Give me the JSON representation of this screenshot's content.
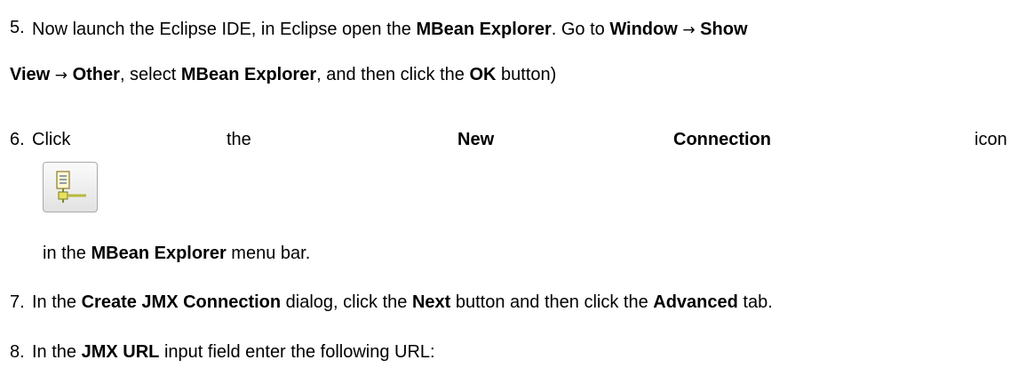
{
  "steps": {
    "s5": {
      "number": "5.",
      "t1": "Now launch the Eclipse IDE, in Eclipse open the ",
      "b1": "MBean Explorer",
      "t2": ". Go to ",
      "b2": "Window",
      "arrow1": "→",
      "b3": "Show",
      "b4": "View",
      "arrow2": "→",
      "b5": "Other",
      "t3": ", select ",
      "b6": "MBean Explorer",
      "t4": ", and then click the ",
      "b7": "OK",
      "t5": " button)"
    },
    "s6": {
      "number": "6.",
      "w1": "Click",
      "w2": "the",
      "w3": "New",
      "w4": "Connection",
      "w5": "icon",
      "icon": "new-connection-icon",
      "t1": "in the ",
      "b1": "MBean Explorer",
      "t2": " menu bar."
    },
    "s7": {
      "number": "7.",
      "t1": "In the ",
      "b1": "Create JMX Connection",
      "t2": " dialog, click the ",
      "b2": "Next",
      "t3": " button and then click the ",
      "b3": "Advanced",
      "t4": " tab."
    },
    "s8": {
      "number": "8.",
      "t1": "In the ",
      "b1": "JMX URL",
      "t2": " input field enter the following URL:"
    }
  }
}
